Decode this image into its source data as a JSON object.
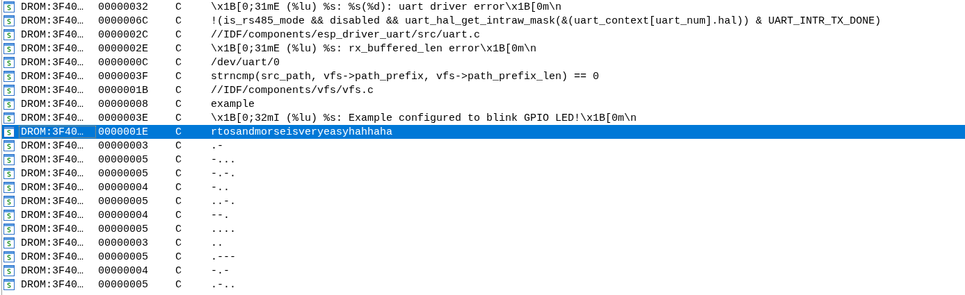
{
  "rows": [
    {
      "address": "DROM:3F40…",
      "length": "00000032",
      "type": "C",
      "string": "\\x1B[0;31mE (%lu) %s: %s(%d): uart driver error\\x1B[0m\\n",
      "selected": false
    },
    {
      "address": "DROM:3F40…",
      "length": "0000006C",
      "type": "C",
      "string": "!(is_rs485_mode && disabled && uart_hal_get_intraw_mask(&(uart_context[uart_num].hal)) & UART_INTR_TX_DONE)",
      "selected": false
    },
    {
      "address": "DROM:3F40…",
      "length": "0000002C",
      "type": "C",
      "string": "//IDF/components/esp_driver_uart/src/uart.c",
      "selected": false
    },
    {
      "address": "DROM:3F40…",
      "length": "0000002E",
      "type": "C",
      "string": "\\x1B[0;31mE (%lu) %s: rx_buffered_len error\\x1B[0m\\n",
      "selected": false
    },
    {
      "address": "DROM:3F40…",
      "length": "0000000C",
      "type": "C",
      "string": "/dev/uart/0",
      "selected": false
    },
    {
      "address": "DROM:3F40…",
      "length": "0000003F",
      "type": "C",
      "string": "strncmp(src_path, vfs->path_prefix, vfs->path_prefix_len) == 0",
      "selected": false
    },
    {
      "address": "DROM:3F40…",
      "length": "0000001B",
      "type": "C",
      "string": "//IDF/components/vfs/vfs.c",
      "selected": false
    },
    {
      "address": "DROM:3F40…",
      "length": "00000008",
      "type": "C",
      "string": "example",
      "selected": false
    },
    {
      "address": "DROM:3F40…",
      "length": "0000003E",
      "type": "C",
      "string": "\\x1B[0;32mI (%lu) %s: Example configured to blink GPIO LED!\\x1B[0m\\n",
      "selected": false
    },
    {
      "address": "DROM:3F40…",
      "length": "0000001E",
      "type": "C",
      "string": "rtosandmorseisveryeasyhahhaha",
      "selected": true
    },
    {
      "address": "DROM:3F40…",
      "length": "00000003",
      "type": "C",
      "string": ".-",
      "selected": false
    },
    {
      "address": "DROM:3F40…",
      "length": "00000005",
      "type": "C",
      "string": "-...",
      "selected": false
    },
    {
      "address": "DROM:3F40…",
      "length": "00000005",
      "type": "C",
      "string": "-.-.",
      "selected": false
    },
    {
      "address": "DROM:3F40…",
      "length": "00000004",
      "type": "C",
      "string": "-..",
      "selected": false
    },
    {
      "address": "DROM:3F40…",
      "length": "00000005",
      "type": "C",
      "string": "..-.",
      "selected": false
    },
    {
      "address": "DROM:3F40…",
      "length": "00000004",
      "type": "C",
      "string": "--.",
      "selected": false
    },
    {
      "address": "DROM:3F40…",
      "length": "00000005",
      "type": "C",
      "string": "....",
      "selected": false
    },
    {
      "address": "DROM:3F40…",
      "length": "00000003",
      "type": "C",
      "string": "..",
      "selected": false
    },
    {
      "address": "DROM:3F40…",
      "length": "00000005",
      "type": "C",
      "string": ".---",
      "selected": false
    },
    {
      "address": "DROM:3F40…",
      "length": "00000004",
      "type": "C",
      "string": "-.-",
      "selected": false
    },
    {
      "address": "DROM:3F40…",
      "length": "00000005",
      "type": "C",
      "string": ".-..",
      "selected": false
    }
  ]
}
